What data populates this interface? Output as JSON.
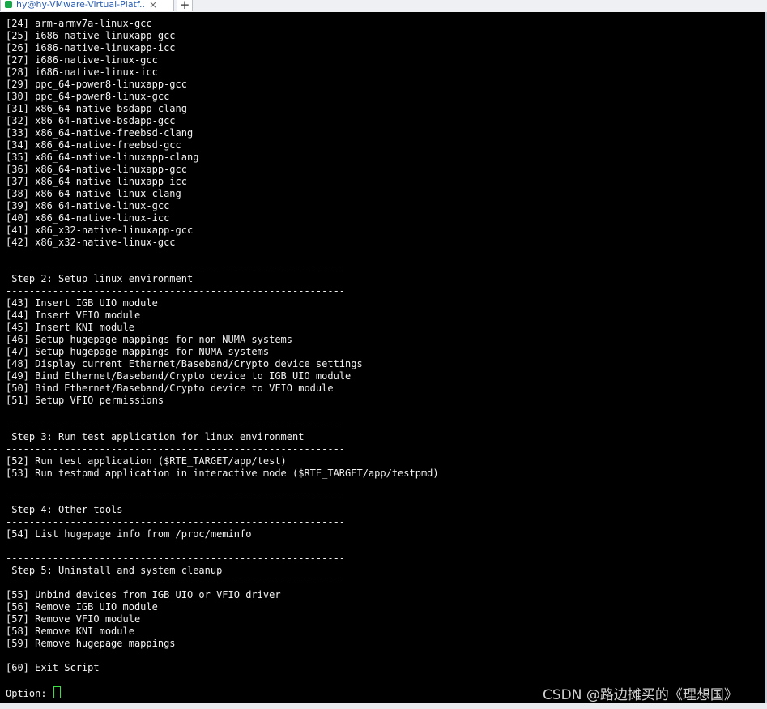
{
  "tab": {
    "title": "hy@hy-VMware-Virtual-Platf...",
    "close": "×",
    "add": "+"
  },
  "terminal": {
    "lines": [
      "[24] arm-armv7a-linux-gcc",
      "[25] i686-native-linuxapp-gcc",
      "[26] i686-native-linuxapp-icc",
      "[27] i686-native-linux-gcc",
      "[28] i686-native-linux-icc",
      "[29] ppc_64-power8-linuxapp-gcc",
      "[30] ppc_64-power8-linux-gcc",
      "[31] x86_64-native-bsdapp-clang",
      "[32] x86_64-native-bsdapp-gcc",
      "[33] x86_64-native-freebsd-clang",
      "[34] x86_64-native-freebsd-gcc",
      "[35] x86_64-native-linuxapp-clang",
      "[36] x86_64-native-linuxapp-gcc",
      "[37] x86_64-native-linuxapp-icc",
      "[38] x86_64-native-linux-clang",
      "[39] x86_64-native-linux-gcc",
      "[40] x86_64-native-linux-icc",
      "[41] x86_x32-native-linuxapp-gcc",
      "[42] x86_x32-native-linux-gcc",
      "",
      "----------------------------------------------------------",
      " Step 2: Setup linux environment",
      "----------------------------------------------------------",
      "[43] Insert IGB UIO module",
      "[44] Insert VFIO module",
      "[45] Insert KNI module",
      "[46] Setup hugepage mappings for non-NUMA systems",
      "[47] Setup hugepage mappings for NUMA systems",
      "[48] Display current Ethernet/Baseband/Crypto device settings",
      "[49] Bind Ethernet/Baseband/Crypto device to IGB UIO module",
      "[50] Bind Ethernet/Baseband/Crypto device to VFIO module",
      "[51] Setup VFIO permissions",
      "",
      "----------------------------------------------------------",
      " Step 3: Run test application for linux environment",
      "----------------------------------------------------------",
      "[52] Run test application ($RTE_TARGET/app/test)",
      "[53] Run testpmd application in interactive mode ($RTE_TARGET/app/testpmd)",
      "",
      "----------------------------------------------------------",
      " Step 4: Other tools",
      "----------------------------------------------------------",
      "[54] List hugepage info from /proc/meminfo",
      "",
      "----------------------------------------------------------",
      " Step 5: Uninstall and system cleanup",
      "----------------------------------------------------------",
      "[55] Unbind devices from IGB UIO or VFIO driver",
      "[56] Remove IGB UIO module",
      "[57] Remove VFIO module",
      "[58] Remove KNI module",
      "[59] Remove hugepage mappings",
      "",
      "[60] Exit Script",
      "",
      "Option: "
    ]
  },
  "watermark": "CSDN @路边摊买的《理想国》",
  "colors": {
    "background": "#000000",
    "text": "#f2f2f2",
    "cursor": "#3be045"
  }
}
